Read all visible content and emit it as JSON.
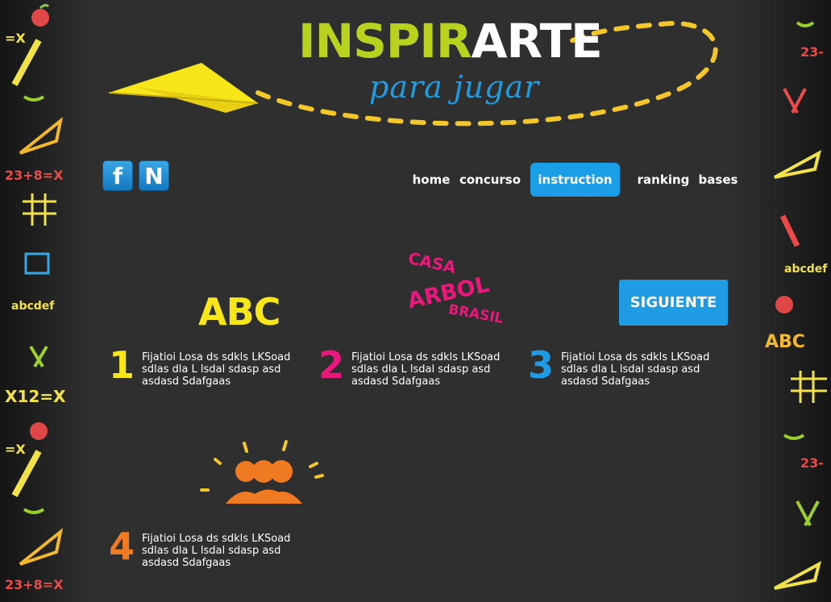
{
  "header": {
    "logo_part1": "INSPIR",
    "logo_part2": "ARTE",
    "subtitle": "para jugar"
  },
  "social": [
    {
      "icon": "facebook-icon",
      "glyph": "f"
    },
    {
      "icon": "n-icon",
      "glyph": "N"
    }
  ],
  "nav": {
    "items": [
      "home",
      "concurso",
      "instruction",
      "ranking",
      "bases"
    ],
    "active": "instruction"
  },
  "steps": [
    {
      "number": "1",
      "logo_text": "ABC",
      "text": "Fijatioi Losa ds sdkls LKSoad sdlas dla L lsdal sdasp asd asdasd Sdafgaas",
      "color": "#f6e61a"
    },
    {
      "number": "2",
      "logo_lines": [
        "CASA",
        "ARBOL",
        "BRASIL"
      ],
      "text": "Fijatioi Losa ds sdkls LKSoad sdlas dla L lsdal sdasp asd asdasd Sdafgaas",
      "color": "#e9197b"
    },
    {
      "number": "3",
      "button": "SIGUIENTE",
      "text": "Fijatioi Losa ds sdkls LKSoad sdlas dla L lsdal sdasp asd asdasd Sdafgaas",
      "color": "#1e9be3"
    },
    {
      "number": "4",
      "icon": "group-people-icon",
      "text": "Fijatioi Losa ds sdkls LKSoad sdlas dla L lsdal sdasp asd asdasd Sdafgaas",
      "color": "#f07a22"
    }
  ],
  "doodles": {
    "left": [
      "=X",
      "23+8=X",
      "abcdef",
      "X12=X",
      "=X",
      "23+8=X"
    ],
    "right": [
      "23-",
      "abcdef",
      "ABC",
      "23-"
    ],
    "colors": [
      "#e94b4b",
      "#f2e24a",
      "#9ccf2a",
      "#35a9e6",
      "#f08a2a",
      "#ffffff"
    ]
  }
}
